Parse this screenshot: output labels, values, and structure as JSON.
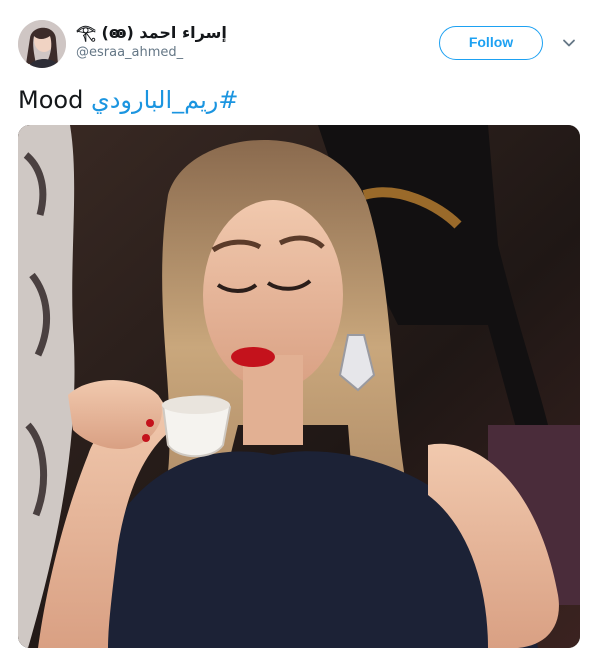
{
  "tweet": {
    "display_name": "إسراء احمد 𓂀 (ꙭ)",
    "handle": "@esraa_ahmed_",
    "follow_label": "Follow",
    "text_plain": "Mood",
    "hashtag": "#ريم_البارودي",
    "media": {
      "description_icon": "photo"
    }
  },
  "colors": {
    "brand": "#1da1f2",
    "hashtag": "#1b95e0",
    "secondary_text": "#657786",
    "primary_text": "#14171a"
  }
}
